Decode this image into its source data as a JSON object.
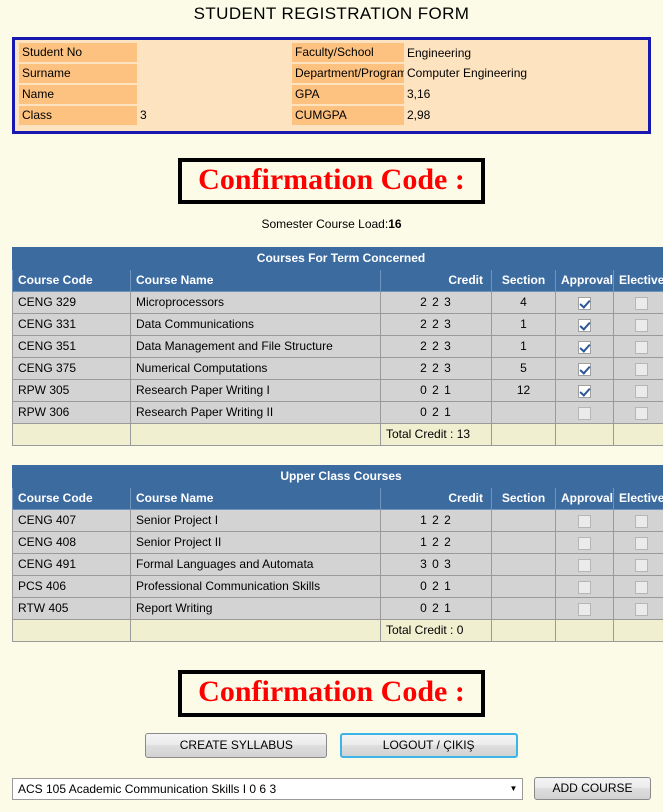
{
  "page": {
    "title": "STUDENT REGISTRATION FORM",
    "background_color": "#fbfbe8",
    "accent_color": "#3c6ba0",
    "confirm_text_color": "#ff0000",
    "info_border_color": "#1818b0"
  },
  "student_info": {
    "rows": [
      {
        "label_left": "Student No",
        "value_left": "",
        "label_right": "Faculty/School",
        "value_right": "Engineering"
      },
      {
        "label_left": "Surname",
        "value_left": "",
        "label_right": "Department/Program",
        "value_right": "Computer Engineering"
      },
      {
        "label_left": "Name",
        "value_left": "",
        "label_right": "GPA",
        "value_right": "3,16"
      },
      {
        "label_left": "Class",
        "value_left": "3",
        "label_right": "CUMGPA",
        "value_right": "2,98"
      }
    ]
  },
  "confirmation_top": {
    "label": "Confirmation Code :"
  },
  "confirmation_bottom": {
    "label": "Confirmation Code :"
  },
  "course_load": {
    "label": "Somester Course Load:",
    "value": "16"
  },
  "tables": [
    {
      "title": "Courses For Term Concerned",
      "columns": {
        "code": "Course Code",
        "name": "Course Name",
        "credit": "Credit",
        "section": "Section",
        "approval": "Approval",
        "elective": "Elective"
      },
      "rows": [
        {
          "code": "CENG 329",
          "name": "Microprocessors",
          "credit": "2 2 3",
          "section": "4",
          "approval": true,
          "elective": false
        },
        {
          "code": "CENG 331",
          "name": "Data Communications",
          "credit": "2 2 3",
          "section": "1",
          "approval": true,
          "elective": false
        },
        {
          "code": "CENG 351",
          "name": "Data Management and File Structure",
          "credit": "2 2 3",
          "section": "1",
          "approval": true,
          "elective": false
        },
        {
          "code": "CENG 375",
          "name": "Numerical Computations",
          "credit": "2 2 3",
          "section": "5",
          "approval": true,
          "elective": false
        },
        {
          "code": "RPW 305",
          "name": "Research Paper Writing I",
          "credit": "0 2 1",
          "section": "12",
          "approval": true,
          "elective": false
        },
        {
          "code": "RPW 306",
          "name": "Research Paper Writing II",
          "credit": "0 2 1",
          "section": "",
          "approval": false,
          "elective": false
        }
      ],
      "total": "Total Credit : 13"
    },
    {
      "title": "Upper Class Courses",
      "columns": {
        "code": "Course Code",
        "name": "Course Name",
        "credit": "Credit",
        "section": "Section",
        "approval": "Approval",
        "elective": "Elective"
      },
      "rows": [
        {
          "code": "CENG 407",
          "name": "Senior Project I",
          "credit": "1 2 2",
          "section": "",
          "approval": false,
          "elective": false
        },
        {
          "code": "CENG 408",
          "name": "Senior Project II",
          "credit": "1 2 2",
          "section": "",
          "approval": false,
          "elective": false
        },
        {
          "code": "CENG 491",
          "name": "Formal Languages and Automata",
          "credit": "3 0 3",
          "section": "",
          "approval": false,
          "elective": false
        },
        {
          "code": "PCS 406",
          "name": "Professional Communication Skills",
          "credit": "0 2 1",
          "section": "",
          "approval": false,
          "elective": false
        },
        {
          "code": "RTW 405",
          "name": "Report Writing",
          "credit": "0 2 1",
          "section": "",
          "approval": false,
          "elective": false
        }
      ],
      "total": "Total Credit : 0"
    }
  ],
  "buttons": {
    "create_syllabus": "CREATE SYLLABUS",
    "logout": "LOGOUT / ÇIKIŞ",
    "add_course": "ADD COURSE"
  },
  "course_select": {
    "selected": "ACS 105 Academic Communication Skills I 0 6 3",
    "arrow_icon": "chevron-down-icon"
  }
}
